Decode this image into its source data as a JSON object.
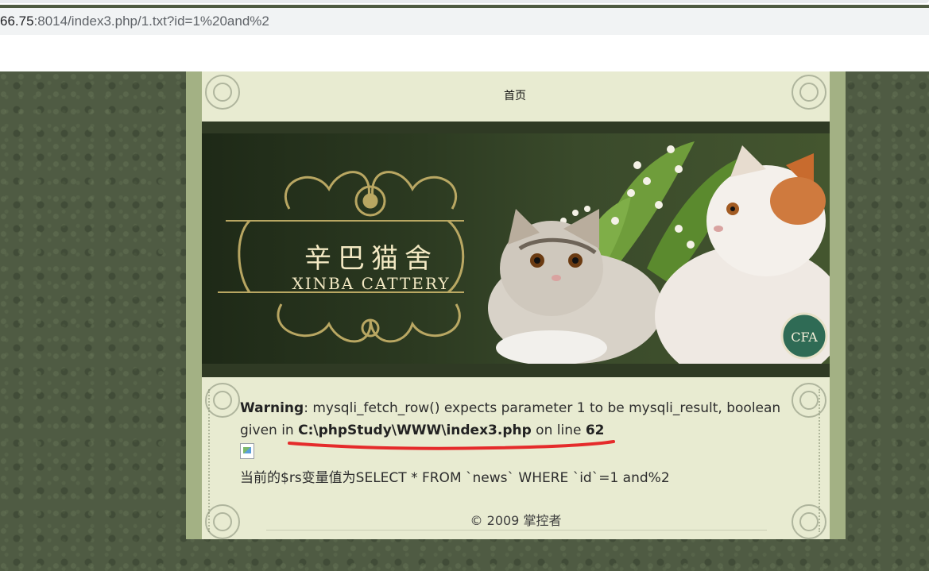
{
  "browser": {
    "url_host": "66.75",
    "url_rest": ":8014/index3.php/1.txt?id=1%20and%2"
  },
  "nav": {
    "home_label": "首页"
  },
  "banner": {
    "logo_cn": "辛巴猫舍",
    "logo_en": "XINBA CATTERY",
    "badge_text": "CFA"
  },
  "warning": {
    "label": "Warning",
    "message_part1": ": mysqli_fetch_row() expects parameter 1 to be mysqli_result, boolean given in ",
    "file_path": "C:\\phpStudy\\WWW\\index3.php",
    "message_part2": " on line ",
    "line_number": "62"
  },
  "sql_output": "当前的$rs变量值为SELECT * FROM `news` WHERE `id`=1 and%2",
  "footer": {
    "copyright": "© 2009 掌控者"
  },
  "colors": {
    "page_background": "#4f5b43",
    "column_frame": "#a3b184",
    "content_background": "#e8ebd1",
    "annotation_red": "#e52b2b"
  }
}
